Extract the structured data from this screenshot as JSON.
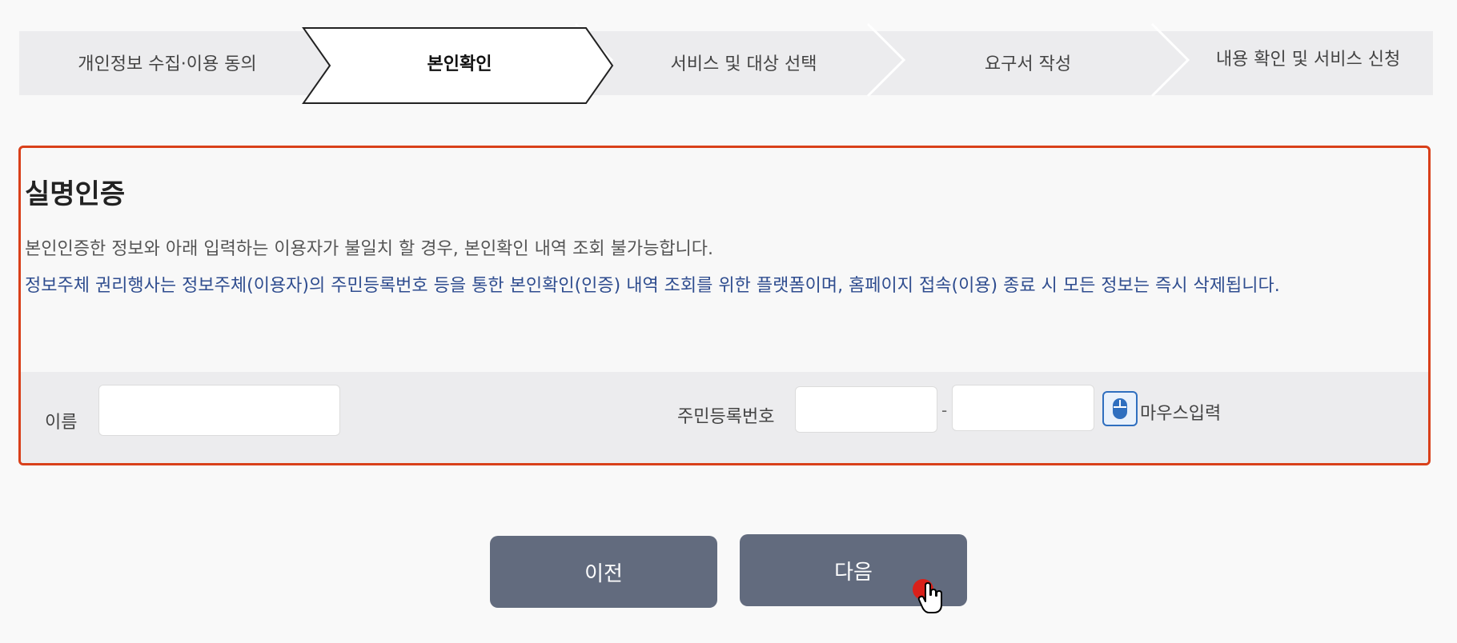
{
  "steps": [
    {
      "label": "개인정보 수집·이용 동의",
      "active": false
    },
    {
      "label": "본인확인",
      "active": true
    },
    {
      "label": "서비스 및 대상 선택",
      "active": false
    },
    {
      "label": "요구서 작성",
      "active": false
    },
    {
      "label": "내용 확인 및 서비스 신청",
      "active": false
    }
  ],
  "auth": {
    "title": "실명인증",
    "notice": "본인인증한 정보와 아래 입력하는 이용자가 불일치 할 경우, 본인확인 내역 조회 불가능합니다.",
    "info": "정보주체 권리행사는 정보주체(이용자)의 주민등록번호 등을 통한 본인확인(인증) 내역 조회를 위한 플랫폼이며, 홈페이지 접속(이용) 종료 시 모든 정보는 즉시 삭제됩니다.",
    "name_label": "이름",
    "name_value": "",
    "rrn_label": "주민등록번호",
    "rrn_front_value": "",
    "rrn_separator": "-",
    "rrn_back_value": "",
    "mouse_input_label": "마우스입력"
  },
  "buttons": {
    "prev": "이전",
    "next": "다음"
  },
  "colors": {
    "highlight_border": "#d9401a",
    "button_bg": "#626b7e",
    "info_text": "#2f4d8f",
    "cursor_dot": "#d9201a"
  },
  "icons": {
    "mouse": "mouse-icon",
    "cursor": "hand-cursor-icon"
  }
}
